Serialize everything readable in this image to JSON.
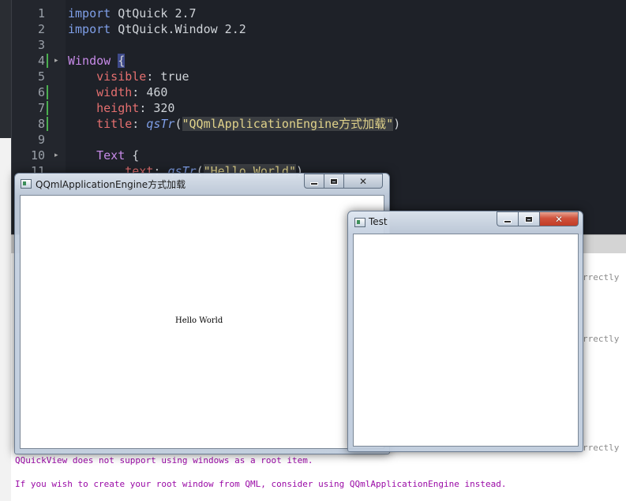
{
  "editor": {
    "lines": [
      {
        "n": "1",
        "parts": [
          [
            "kw",
            "import"
          ],
          [
            "plain",
            " QtQuick 2.7"
          ]
        ]
      },
      {
        "n": "2",
        "parts": [
          [
            "kw",
            "import"
          ],
          [
            "plain",
            " QtQuick.Window 2.2"
          ]
        ]
      },
      {
        "n": "3",
        "parts": []
      },
      {
        "n": "4",
        "parts": [
          [
            "type",
            "Window"
          ],
          [
            "plain",
            " "
          ],
          [
            "brace-hl",
            "{"
          ]
        ],
        "fold": "▸",
        "changed": true
      },
      {
        "n": "5",
        "parts": [
          [
            "plain",
            "    "
          ],
          [
            "prop",
            "visible"
          ],
          [
            "plain",
            ": true"
          ]
        ]
      },
      {
        "n": "6",
        "parts": [
          [
            "plain",
            "    "
          ],
          [
            "prop",
            "width"
          ],
          [
            "plain",
            ": 460"
          ]
        ],
        "changed": true
      },
      {
        "n": "7",
        "parts": [
          [
            "plain",
            "    "
          ],
          [
            "prop",
            "height"
          ],
          [
            "plain",
            ": 320"
          ]
        ],
        "changed": true
      },
      {
        "n": "8",
        "parts": [
          [
            "plain",
            "    "
          ],
          [
            "prop",
            "title"
          ],
          [
            "plain",
            ": "
          ],
          [
            "func",
            "qsTr"
          ],
          [
            "plain",
            "("
          ],
          [
            "str",
            "\"QQmlApplicationEngine方式加载\""
          ],
          [
            "plain",
            ")"
          ]
        ],
        "changed": true
      },
      {
        "n": "9",
        "parts": []
      },
      {
        "n": "10",
        "parts": [
          [
            "plain",
            "    "
          ],
          [
            "type",
            "Text"
          ],
          [
            "plain",
            " {"
          ]
        ],
        "fold": "▸"
      },
      {
        "n": "11",
        "parts": [
          [
            "plain",
            "        "
          ],
          [
            "prop",
            "text"
          ],
          [
            "plain",
            ": "
          ],
          [
            "func",
            "qsTr"
          ],
          [
            "plain",
            "("
          ],
          [
            "str",
            "\"Hello World\""
          ],
          [
            "plain",
            ")"
          ]
        ]
      }
    ]
  },
  "output": {
    "fragments": [
      "rrectly",
      "rrectly",
      "rrectly"
    ],
    "messages": [
      "QQuickView does not support using windows as a root item.",
      "If you wish to create your root window from QML, consider using QQmlApplicationEngine instead."
    ]
  },
  "window_engine": {
    "title": "QQmlApplicationEngine方式加载",
    "text": "Hello World"
  },
  "window_test": {
    "title": "Test"
  },
  "icons": {
    "minimize": "minimize-icon",
    "maximize": "maximize-icon",
    "close": "close-icon",
    "app": "qt-app-icon"
  },
  "colors": {
    "editor_bg": "#1e2128",
    "keyword": "#7f9fe8",
    "type": "#c78ae8",
    "property": "#e46f6f",
    "string": "#e0d28a",
    "output_text": "#9a0aa6",
    "close_button": "#c23c26"
  }
}
